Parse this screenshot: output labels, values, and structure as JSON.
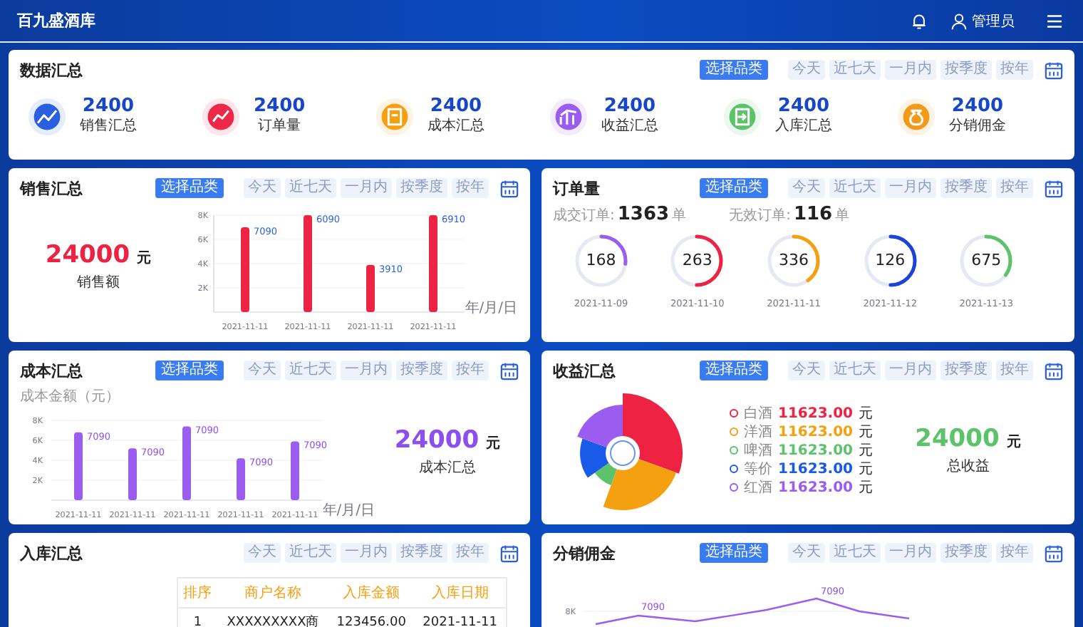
{
  "header": {
    "title": "百九盛酒库",
    "user": "管理员"
  },
  "summary": {
    "title": "数据汇总",
    "pick_button": "选择品类",
    "filters": [
      "今天",
      "近七天",
      "一月内",
      "按季度",
      "按年"
    ],
    "items": [
      {
        "value": "2400",
        "label": "销售汇总",
        "color": "#2a5fe0"
      },
      {
        "value": "2400",
        "label": "订单量",
        "color": "#ee2848"
      },
      {
        "value": "2400",
        "label": "成本汇总",
        "color": "#f5a011"
      },
      {
        "value": "2400",
        "label": "收益汇总",
        "color": "#9b5cf0"
      },
      {
        "value": "2400",
        "label": "入库汇总",
        "color": "#5cc36a"
      },
      {
        "value": "2400",
        "label": "分销佣金",
        "color": "#f39a1a"
      }
    ]
  },
  "sales": {
    "title": "销售汇总",
    "pick_button": "选择品类",
    "filters": [
      "今天",
      "近七天",
      "一月内",
      "按季度",
      "按年"
    ],
    "total": "24000",
    "unit": "元",
    "total_label": "销售额",
    "chart_data": {
      "type": "bar",
      "categories": [
        "2021-11-11",
        "2021-11-11",
        "2021-11-11",
        "2021-11-11"
      ],
      "series": [
        {
          "color": "#ee2242",
          "values": [
            7000,
            8000,
            3900,
            8000
          ]
        }
      ],
      "grid": true,
      "ylim": [
        0,
        8000
      ],
      "yticks": [
        {
          "value": 2000,
          "label": "2K"
        },
        {
          "value": 4000,
          "label": "4K"
        },
        {
          "value": 6000,
          "label": "6K"
        },
        {
          "value": 8000,
          "label": "8K"
        }
      ],
      "xlabel": "年/月/日",
      "value_labels": [
        "7090",
        "6090",
        "3910",
        "6910"
      ]
    }
  },
  "orders": {
    "title": "订单量",
    "pick_button": "选择品类",
    "filters": [
      "今天",
      "近七天",
      "一月内",
      "按季度",
      "按年"
    ],
    "stats": [
      {
        "label": "成交订单:",
        "value": "1363",
        "unit": "单"
      },
      {
        "label": "无效订单:",
        "value": "116",
        "unit": "单"
      }
    ],
    "rings": [
      {
        "value": "168",
        "date": "2021-11-09",
        "level": 0.27,
        "color": "#9b5cf0"
      },
      {
        "value": "263",
        "date": "2021-11-10",
        "level": 0.5,
        "color": "#ee2242"
      },
      {
        "value": "336",
        "date": "2021-11-11",
        "level": 0.4,
        "color": "#f5a011"
      },
      {
        "value": "126",
        "date": "2021-11-12",
        "level": 0.5,
        "color": "#1a44d8"
      },
      {
        "value": "675",
        "date": "2021-11-13",
        "level": 0.35,
        "color": "#5cc36a"
      }
    ]
  },
  "cost": {
    "title": "成本汇总",
    "pick_button": "选择品类",
    "filters": [
      "今天",
      "近七天",
      "一月内",
      "按季度",
      "按年"
    ],
    "total": "24000",
    "unit": "元",
    "total_label": "成本汇总",
    "chart_data": {
      "type": "bar",
      "categories": [
        "2021-11-11",
        "2021-11-11",
        "2021-11-11",
        "2021-11-11",
        "2021-11-11"
      ],
      "series": [
        {
          "color": "#9b5cf0",
          "values": [
            6800,
            5200,
            7400,
            4200,
            5900
          ]
        }
      ],
      "grid": true,
      "ylim": [
        0,
        8000
      ],
      "yticks": [
        {
          "value": 2000,
          "label": "2K"
        },
        {
          "value": 4000,
          "label": "4K"
        },
        {
          "value": 6000,
          "label": "6K"
        },
        {
          "value": 8000,
          "label": "8K"
        }
      ],
      "ylabel": "成本金额（元）",
      "xlabel": "年/月/日",
      "value_labels": [
        "7090",
        "7090",
        "7090",
        "7090",
        "7090"
      ]
    }
  },
  "revenue": {
    "title": "收益汇总",
    "pick_button": "选择品类",
    "filters": [
      "今天",
      "近七天",
      "一月内",
      "按季度",
      "按年"
    ],
    "total": "24000",
    "unit": "元",
    "total_label": "总收益",
    "legend": [
      {
        "label": "白酒",
        "value": "11623.00",
        "unit": "元",
        "color": "#ee2242"
      },
      {
        "label": "洋酒",
        "value": "11623.00",
        "unit": "元",
        "color": "#f5a011"
      },
      {
        "label": "啤酒",
        "value": "11623.00",
        "unit": "元",
        "color": "#5cc36a"
      },
      {
        "label": "等价",
        "value": "11623.00",
        "unit": "元",
        "color": "#1a5ae8"
      },
      {
        "label": "红酒",
        "value": "11623.00",
        "unit": "元",
        "color": "#9b5cf0"
      }
    ]
  },
  "inbound": {
    "title": "入库汇总",
    "filters": [
      "今天",
      "近七天",
      "一月内",
      "按季度",
      "按年"
    ],
    "table": {
      "columns": [
        "排序",
        "商户名称",
        "入库金额",
        "入库日期"
      ],
      "rows": [
        [
          "1",
          "XXXXXXXXX商",
          "123456.00",
          "2021-11-11"
        ]
      ]
    }
  },
  "commission": {
    "title": "分销佣金",
    "pick_button": "选择品类",
    "filters": [
      "今天",
      "近七天",
      "一月内",
      "按季度",
      "按年"
    ],
    "chart_tick": "8K",
    "point_labels": [
      "7090",
      "7090"
    ]
  }
}
